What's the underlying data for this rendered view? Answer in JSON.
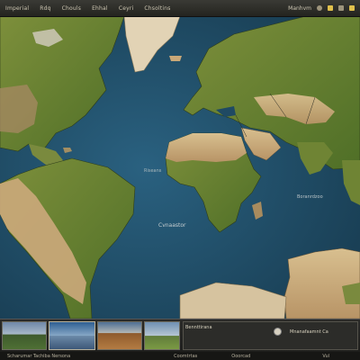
{
  "topbar": {
    "items": [
      "Imperial",
      "Rdq",
      "Chouls",
      "Ehhal",
      "Ceyri",
      "Chsoltins"
    ],
    "right_label": "Manhvm"
  },
  "map": {
    "labels": [
      "Cvnaastor",
      "Boranrdzoo",
      "Riseans"
    ]
  },
  "bottom": {
    "thumbnails": [
      "landscape-1",
      "landscape-2",
      "landscape-3",
      "landscape-4"
    ],
    "info_left": "Bennttirana",
    "info_right": "Mnanafaamnt Ca",
    "status": [
      "Scharumar Tachiba Nersona",
      "Coomtrtas",
      "Ooorcad",
      "Vul"
    ]
  },
  "colors": {
    "ocean": "#1f4a63",
    "land_green": "#5f7f2f",
    "land_tan": "#c9a878"
  }
}
